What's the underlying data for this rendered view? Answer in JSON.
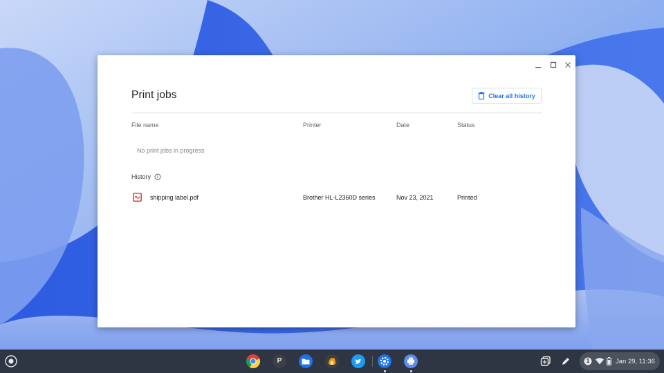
{
  "app": {
    "title": "Print jobs",
    "clear_history_label": "Clear all history"
  },
  "table": {
    "columns": [
      "File name",
      "Printer",
      "Date",
      "Status"
    ],
    "in_progress_empty": "No print jobs in progress",
    "history_label": "History",
    "history": [
      {
        "file_name": "shipping label.pdf",
        "printer": "Brother HL-L2360D series",
        "date": "Nov 23, 2021",
        "status": "Printed",
        "icon": "pdf-file-icon"
      }
    ]
  },
  "shelf": {
    "apps": [
      {
        "name": "chrome-icon"
      },
      {
        "name": "p-app-icon",
        "letter": "P"
      },
      {
        "name": "files-icon"
      },
      {
        "name": "fox-app-icon"
      },
      {
        "name": "twitter-icon"
      },
      {
        "name": "settings-icon"
      },
      {
        "name": "print-jobs-icon"
      }
    ],
    "notification_count": "1",
    "datetime": "Jan 29, 11:36"
  },
  "colors": {
    "accent": "#1a73e8",
    "pdf_red": "#d93025",
    "shelf": "#282c34"
  }
}
